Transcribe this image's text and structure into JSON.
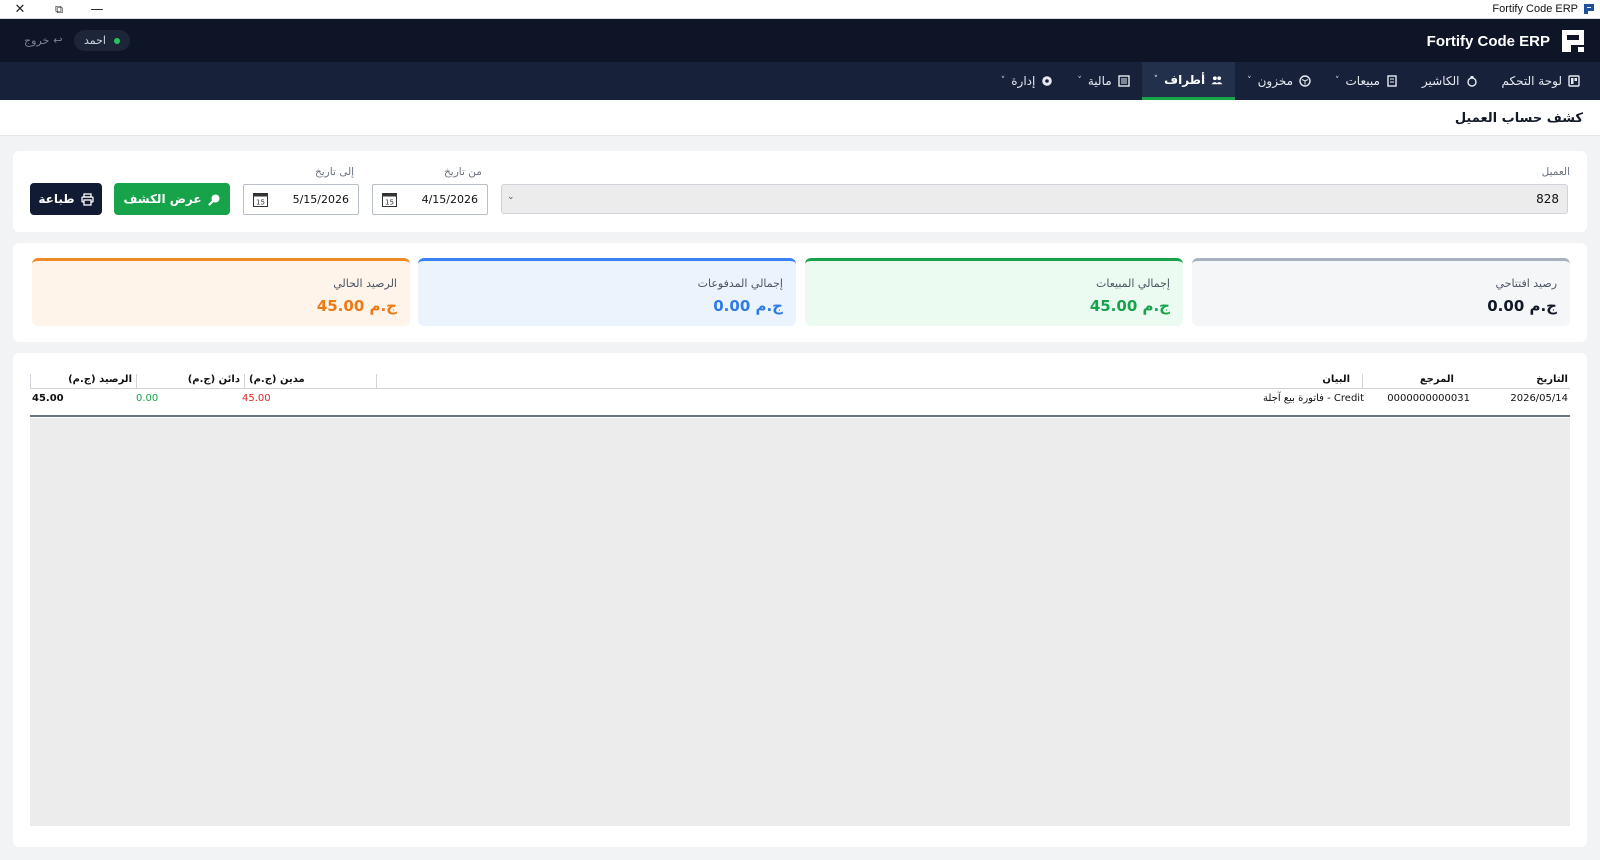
{
  "window": {
    "title": "Fortify Code ERP",
    "close_glyph": "✕",
    "maximize_glyph": "⧉",
    "minimize_glyph": "—"
  },
  "header": {
    "brand": "Fortify Code ERP",
    "user_name": "احمد",
    "logout_label": "خروج",
    "online_color": "#22c55e"
  },
  "nav": {
    "items": [
      {
        "label": "لوحة التحكم",
        "icon": "dashboard-icon",
        "has_caret": false,
        "active": false
      },
      {
        "label": "الكاشير",
        "icon": "cashier-icon",
        "has_caret": false,
        "active": false
      },
      {
        "label": "مبيعات",
        "icon": "receipt-icon",
        "has_caret": true,
        "active": false
      },
      {
        "label": "مخزون",
        "icon": "box-icon",
        "has_caret": true,
        "active": false
      },
      {
        "label": "أطراف",
        "icon": "users-icon",
        "has_caret": true,
        "active": true
      },
      {
        "label": "مالية",
        "icon": "finance-icon",
        "has_caret": true,
        "active": false
      },
      {
        "label": "إدارة",
        "icon": "gear-icon",
        "has_caret": true,
        "active": false
      }
    ],
    "caret": "˅",
    "accent": "#16a34a"
  },
  "page": {
    "title": "كشف حساب العميل"
  },
  "filters": {
    "customer_label": "العميل",
    "customer_value": "828",
    "from_label": "من تاريخ",
    "from_value": "4/15/2026",
    "to_label": "إلى تاريخ",
    "to_value": "5/15/2026",
    "calendar_day": "15",
    "show_button": "عرض الكشف",
    "print_button": "طباعة"
  },
  "summary": {
    "opening": {
      "label": "رصيد افتتاحي",
      "value": "0.00 ج.م"
    },
    "sales": {
      "label": "إجمالي المبيعات",
      "value": "45.00 ج.م"
    },
    "payments": {
      "label": "إجمالي المدفوعات",
      "value": "0.00 ج.م"
    },
    "current": {
      "label": "الرصيد الحالي",
      "value": "45.00 ج.م"
    }
  },
  "table": {
    "columns": [
      "التاريخ",
      "المرجع",
      "البيان",
      "مدين (ج.م)",
      "دائن (ج.م)",
      "الرصيد (ج.م)"
    ],
    "rows": [
      {
        "date": "2026/05/14",
        "ref": "0000000000031",
        "desc": "فاتورة بيع آجلة - Credit",
        "debit": "45.00",
        "credit": "0.00",
        "balance": "45.00"
      }
    ]
  }
}
